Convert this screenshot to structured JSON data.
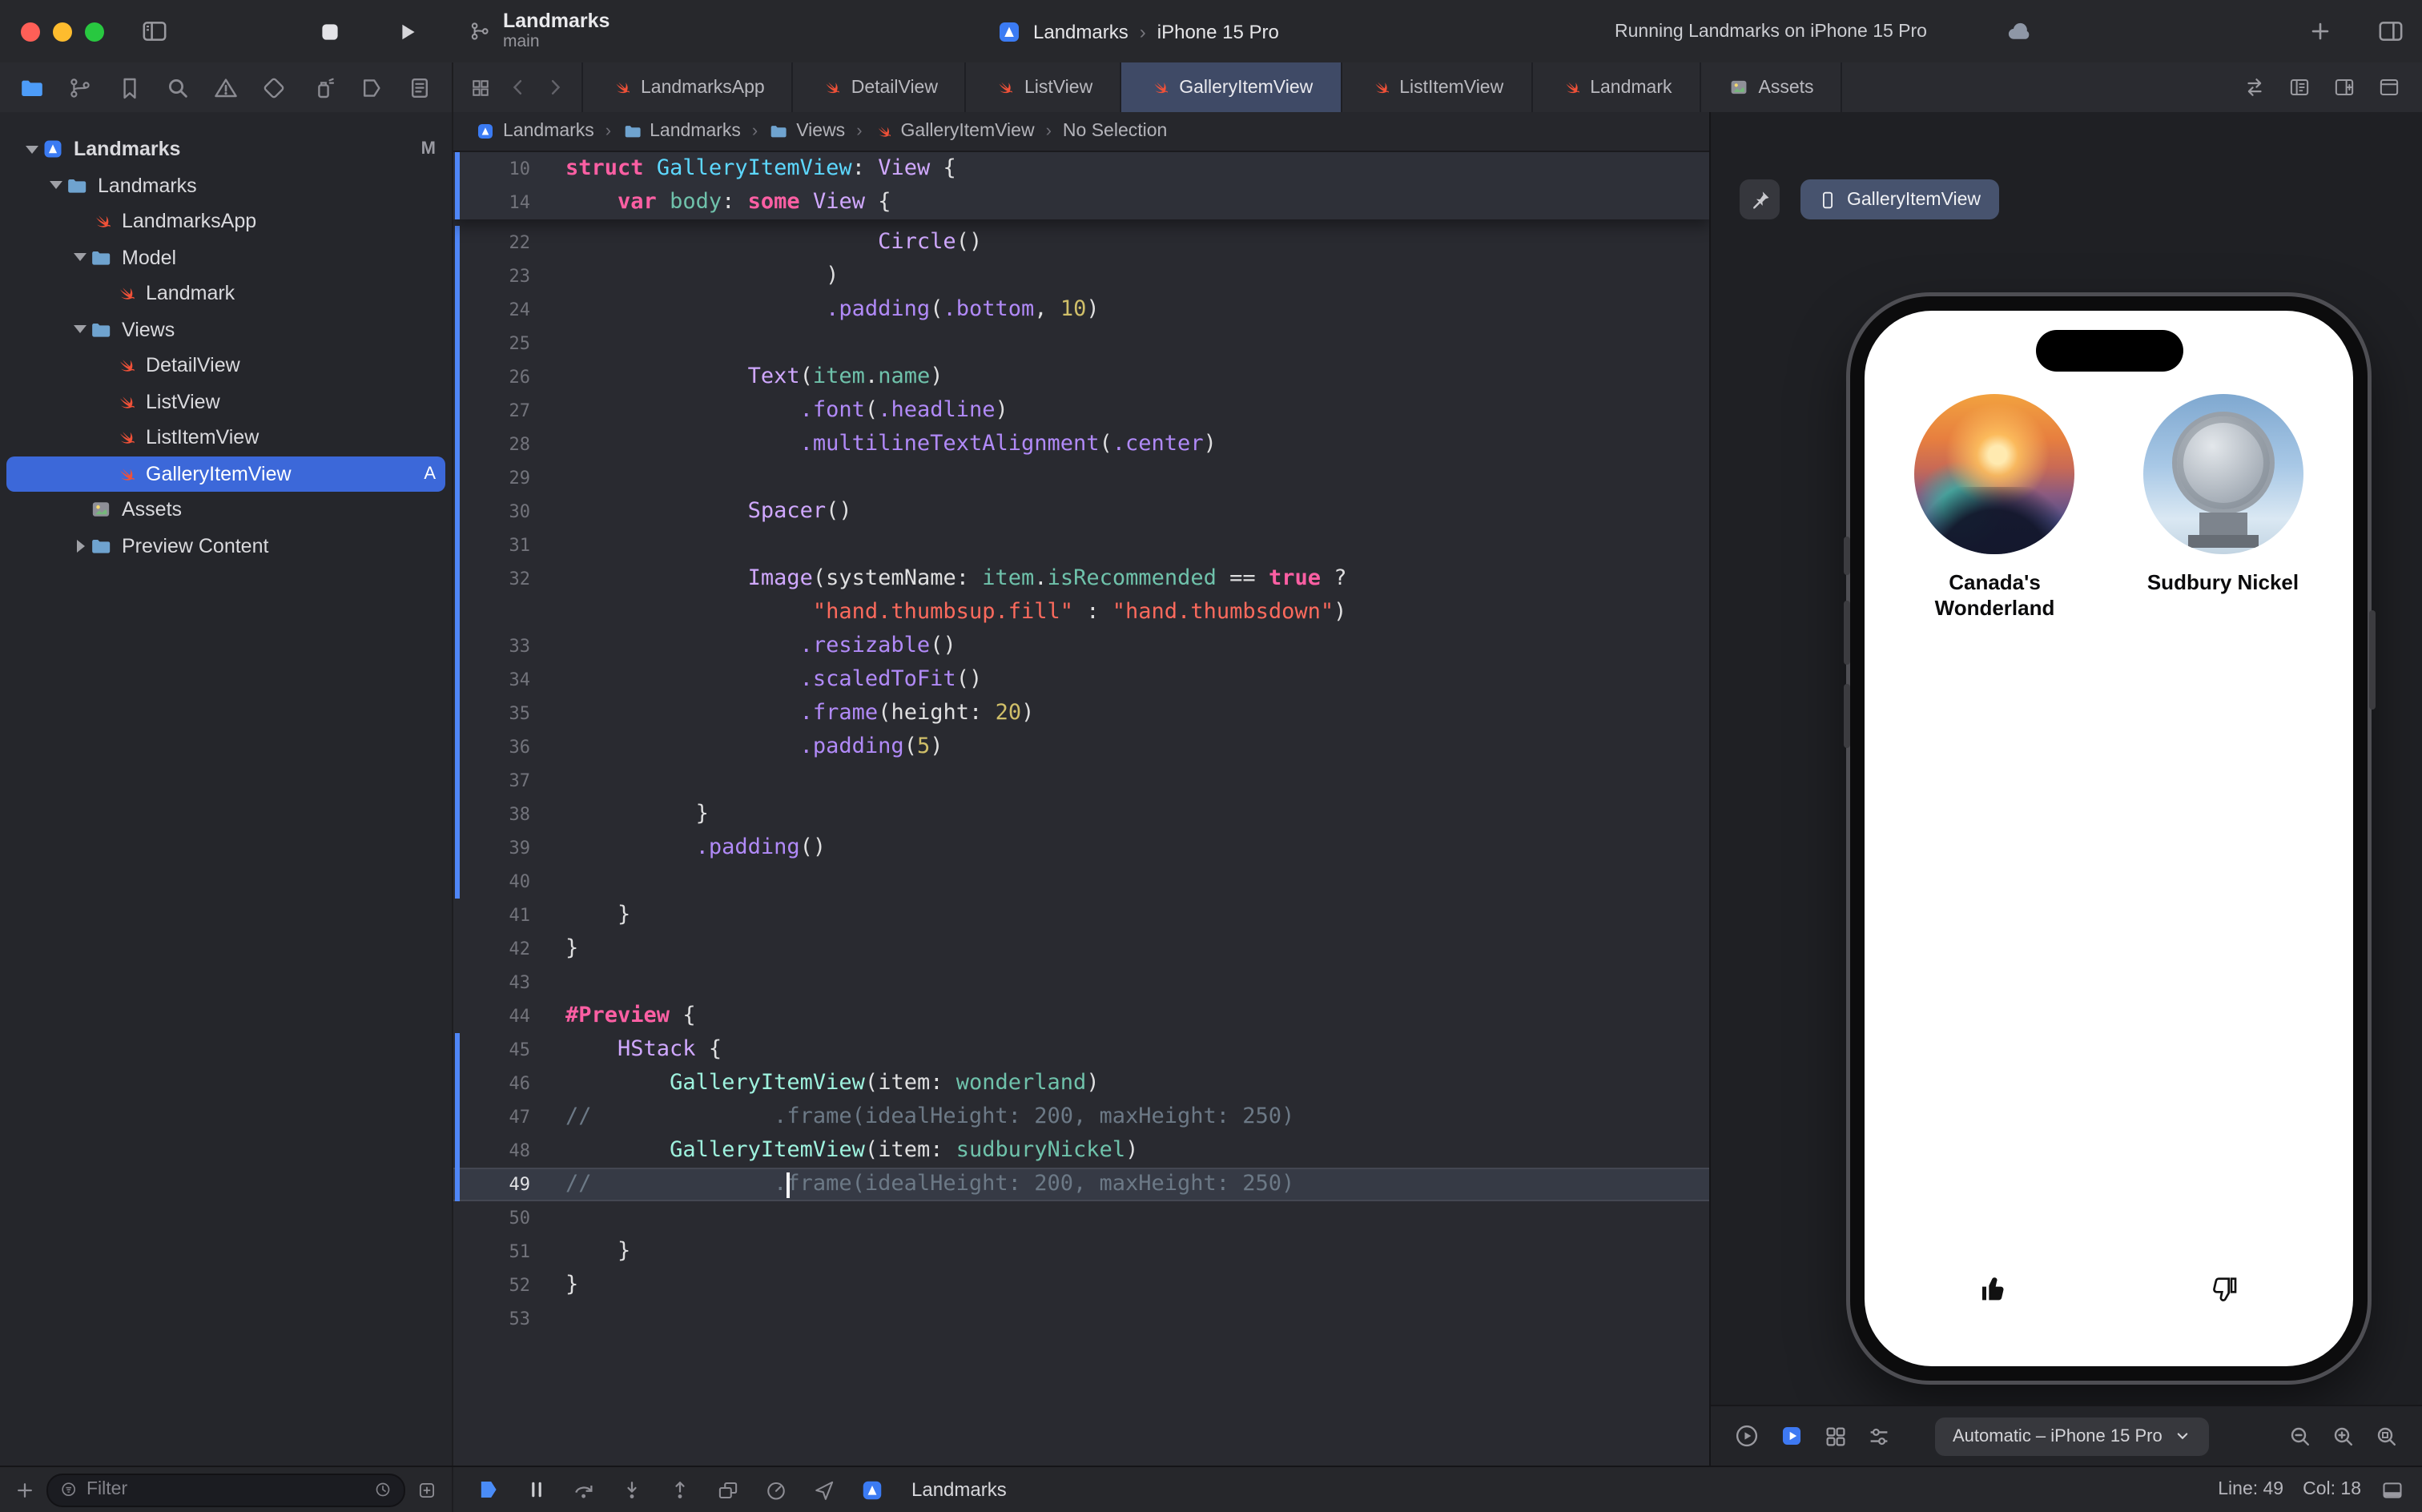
{
  "colors": {
    "accent": "#3e79f2",
    "selection": "#3c68d9",
    "swift_orange": "#F05138",
    "keyword": "#fc5fa3",
    "sdk_type": "#d0a8ff",
    "decl_type": "#5dd8ff",
    "project_type": "#9ef2de",
    "sdk_member": "#b18af8",
    "project_member": "#6fc2ab",
    "string": "#fc6a5d",
    "number": "#d0bf69",
    "comment": "#6c7986",
    "plain": "#dfdfe0"
  },
  "titlebar": {
    "project": "Landmarks",
    "branch": "main",
    "scheme": "Landmarks",
    "destination": "iPhone 15 Pro",
    "status": "Running Landmarks on iPhone 15 Pro"
  },
  "navigator": {
    "items": [
      "project",
      "source-control",
      "bookmarks",
      "find",
      "issues",
      "tests",
      "debug",
      "breakpoints",
      "reports"
    ],
    "active": "project"
  },
  "tabs": [
    {
      "label": "LandmarksApp",
      "icon": "swift"
    },
    {
      "label": "DetailView",
      "icon": "swift"
    },
    {
      "label": "ListView",
      "icon": "swift"
    },
    {
      "label": "GalleryItemView",
      "icon": "swift",
      "active": true
    },
    {
      "label": "ListItemView",
      "icon": "swift"
    },
    {
      "label": "Landmark",
      "icon": "swift"
    },
    {
      "label": "Assets",
      "icon": "assets"
    }
  ],
  "breadcrumb": [
    {
      "label": "Landmarks",
      "icon": "app"
    },
    {
      "label": "Landmarks",
      "icon": "folder"
    },
    {
      "label": "Views",
      "icon": "folder"
    },
    {
      "label": "GalleryItemView",
      "icon": "swift"
    },
    {
      "label": "No Selection",
      "icon": ""
    }
  ],
  "sidebar": {
    "items": [
      {
        "label": "Landmarks",
        "icon": "app",
        "depth": 0,
        "disclosure": "open",
        "badge": "M"
      },
      {
        "label": "Landmarks",
        "icon": "folder",
        "depth": 1,
        "disclosure": "open"
      },
      {
        "label": "LandmarksApp",
        "icon": "swift",
        "depth": 2
      },
      {
        "label": "Model",
        "icon": "folder",
        "depth": 2,
        "disclosure": "open"
      },
      {
        "label": "Landmark",
        "icon": "swift",
        "depth": 3
      },
      {
        "label": "Views",
        "icon": "folder",
        "depth": 2,
        "disclosure": "open"
      },
      {
        "label": "DetailView",
        "icon": "swift",
        "depth": 3
      },
      {
        "label": "ListView",
        "icon": "swift",
        "depth": 3
      },
      {
        "label": "ListItemView",
        "icon": "swift",
        "depth": 3
      },
      {
        "label": "GalleryItemView",
        "icon": "swift",
        "depth": 3,
        "selected": true,
        "badge": "A"
      },
      {
        "label": "Assets",
        "icon": "assets",
        "depth": 2
      },
      {
        "label": "Preview Content",
        "icon": "folder",
        "depth": 2,
        "disclosure": "closed"
      }
    ]
  },
  "editor": {
    "cursor": {
      "line": 49,
      "col": 18
    },
    "sticky": [
      {
        "n": "10",
        "changed": true,
        "tokens": [
          [
            "struct",
            "k"
          ],
          [
            " ",
            "p"
          ],
          [
            "GalleryItemView",
            "d"
          ],
          [
            ": ",
            "p"
          ],
          [
            "View",
            "t"
          ],
          [
            " {",
            "p"
          ]
        ]
      },
      {
        "n": "14",
        "changed": true,
        "tokens": [
          [
            "    ",
            "p"
          ],
          [
            "var",
            "k"
          ],
          [
            " ",
            "p"
          ],
          [
            "body",
            "v"
          ],
          [
            ": ",
            "p"
          ],
          [
            "some",
            "k"
          ],
          [
            " ",
            "p"
          ],
          [
            "View",
            "t"
          ],
          [
            " {",
            "p"
          ]
        ]
      }
    ],
    "lines": [
      {
        "n": "22",
        "changed": true,
        "tokens": [
          [
            "                        ",
            "p"
          ],
          [
            "Circle",
            "t"
          ],
          [
            "()",
            "p"
          ]
        ]
      },
      {
        "n": "23",
        "changed": true,
        "tokens": [
          [
            "                    ",
            "p"
          ],
          [
            ")",
            "p"
          ]
        ]
      },
      {
        "n": "24",
        "changed": true,
        "tokens": [
          [
            "                    ",
            "p"
          ],
          [
            ".padding",
            "m"
          ],
          [
            "(",
            "p"
          ],
          [
            ".bottom",
            "m"
          ],
          [
            ", ",
            "p"
          ],
          [
            "10",
            "n"
          ],
          [
            ")",
            "p"
          ]
        ]
      },
      {
        "n": "25",
        "changed": true,
        "tokens": []
      },
      {
        "n": "26",
        "changed": true,
        "tokens": [
          [
            "              ",
            "p"
          ],
          [
            "Text",
            "t"
          ],
          [
            "(",
            "p"
          ],
          [
            "item",
            "v"
          ],
          [
            ".",
            "p"
          ],
          [
            "name",
            "v"
          ],
          [
            ")",
            "p"
          ]
        ]
      },
      {
        "n": "27",
        "changed": true,
        "tokens": [
          [
            "                  ",
            "p"
          ],
          [
            ".font",
            "m"
          ],
          [
            "(",
            "p"
          ],
          [
            ".headline",
            "m"
          ],
          [
            ")",
            "p"
          ]
        ]
      },
      {
        "n": "28",
        "changed": true,
        "tokens": [
          [
            "                  ",
            "p"
          ],
          [
            ".multilineTextAlignment",
            "m"
          ],
          [
            "(",
            "p"
          ],
          [
            ".center",
            "m"
          ],
          [
            ")",
            "p"
          ]
        ]
      },
      {
        "n": "29",
        "changed": true,
        "tokens": []
      },
      {
        "n": "30",
        "changed": true,
        "tokens": [
          [
            "              ",
            "p"
          ],
          [
            "Spacer",
            "t"
          ],
          [
            "()",
            "p"
          ]
        ]
      },
      {
        "n": "31",
        "changed": true,
        "tokens": []
      },
      {
        "n": "32",
        "changed": true,
        "tokens": [
          [
            "              ",
            "p"
          ],
          [
            "Image",
            "t"
          ],
          [
            "(",
            "p"
          ],
          [
            "systemName",
            "p"
          ],
          [
            ": ",
            "p"
          ],
          [
            "item",
            "v"
          ],
          [
            ".",
            "p"
          ],
          [
            "isRecommended",
            "v"
          ],
          [
            " == ",
            "p"
          ],
          [
            "true",
            "k"
          ],
          [
            " ?",
            "p"
          ]
        ]
      },
      {
        "n": "",
        "changed": true,
        "tokens": [
          [
            "                   ",
            "p"
          ],
          [
            "\"hand.thumbsup.fill\"",
            "s"
          ],
          [
            " : ",
            "p"
          ],
          [
            "\"hand.thumbsdown\"",
            "s"
          ],
          [
            ")",
            "p"
          ]
        ]
      },
      {
        "n": "33",
        "changed": true,
        "tokens": [
          [
            "                  ",
            "p"
          ],
          [
            ".resizable",
            "m"
          ],
          [
            "()",
            "p"
          ]
        ]
      },
      {
        "n": "34",
        "changed": true,
        "tokens": [
          [
            "                  ",
            "p"
          ],
          [
            ".scaledToFit",
            "m"
          ],
          [
            "()",
            "p"
          ]
        ]
      },
      {
        "n": "35",
        "changed": true,
        "tokens": [
          [
            "                  ",
            "p"
          ],
          [
            ".frame",
            "m"
          ],
          [
            "(",
            "p"
          ],
          [
            "height",
            "p"
          ],
          [
            ": ",
            "p"
          ],
          [
            "20",
            "n"
          ],
          [
            ")",
            "p"
          ]
        ]
      },
      {
        "n": "36",
        "changed": true,
        "tokens": [
          [
            "                  ",
            "p"
          ],
          [
            ".padding",
            "m"
          ],
          [
            "(",
            "p"
          ],
          [
            "5",
            "n"
          ],
          [
            ")",
            "p"
          ]
        ]
      },
      {
        "n": "37",
        "changed": true,
        "tokens": []
      },
      {
        "n": "38",
        "changed": true,
        "tokens": [
          [
            "          ",
            "p"
          ],
          [
            "}",
            "p"
          ]
        ]
      },
      {
        "n": "39",
        "changed": true,
        "tokens": [
          [
            "          ",
            "p"
          ],
          [
            ".padding",
            "m"
          ],
          [
            "()",
            "p"
          ]
        ]
      },
      {
        "n": "40",
        "changed": true,
        "tokens": []
      },
      {
        "n": "41",
        "tokens": [
          [
            "    ",
            "p"
          ],
          [
            "}",
            "p"
          ]
        ]
      },
      {
        "n": "42",
        "tokens": [
          [
            "}",
            "p"
          ]
        ]
      },
      {
        "n": "43",
        "tokens": []
      },
      {
        "n": "44",
        "tokens": [
          [
            "#Preview",
            "k"
          ],
          [
            " {",
            "p"
          ]
        ]
      },
      {
        "n": "45",
        "changed": true,
        "tokens": [
          [
            "    ",
            "p"
          ],
          [
            "HStack",
            "t"
          ],
          [
            " {",
            "p"
          ]
        ]
      },
      {
        "n": "46",
        "changed": true,
        "tokens": [
          [
            "        ",
            "p"
          ],
          [
            "GalleryItemView",
            "pj"
          ],
          [
            "(",
            "p"
          ],
          [
            "item",
            "p"
          ],
          [
            ": ",
            "p"
          ],
          [
            "wonderland",
            "v"
          ],
          [
            ")",
            "p"
          ]
        ]
      },
      {
        "n": "47",
        "changed": true,
        "tokens": [
          [
            "//              .frame(idealHeight: 200, maxHeight: 250)",
            "c"
          ]
        ]
      },
      {
        "n": "48",
        "changed": true,
        "tokens": [
          [
            "        ",
            "p"
          ],
          [
            "GalleryItemView",
            "pj"
          ],
          [
            "(",
            "p"
          ],
          [
            "item",
            "p"
          ],
          [
            ": ",
            "p"
          ],
          [
            "sudburyNickel",
            "v"
          ],
          [
            ")",
            "p"
          ]
        ]
      },
      {
        "n": "49",
        "changed": true,
        "current": true,
        "tokens": [
          [
            "//              .frame(idealHeight: 200, maxHeight: 250)",
            "c"
          ]
        ]
      },
      {
        "n": "50",
        "tokens": []
      },
      {
        "n": "51",
        "tokens": [
          [
            "    ",
            "p"
          ],
          [
            "}",
            "p"
          ]
        ]
      },
      {
        "n": "52",
        "tokens": [
          [
            "}",
            "p"
          ]
        ]
      },
      {
        "n": "53",
        "tokens": []
      }
    ]
  },
  "canvas": {
    "preview_tab": "GalleryItemView",
    "device": "Automatic – iPhone 15 Pro",
    "items": [
      {
        "name": "Canada's Wonderland",
        "image": "wonderland",
        "thumb": "up"
      },
      {
        "name": "Sudbury Nickel",
        "image": "nickel",
        "thumb": "down"
      }
    ]
  },
  "statusbar": {
    "filter_placeholder": "Filter",
    "app_name": "Landmarks",
    "line": "Line: 49",
    "col": "Col: 18"
  }
}
